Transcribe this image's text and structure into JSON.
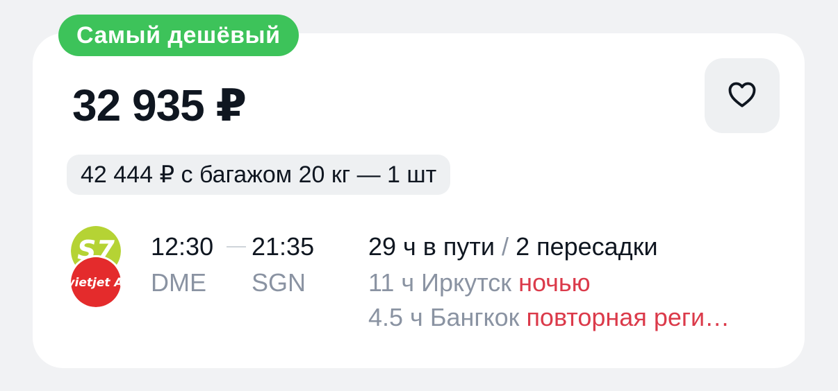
{
  "badge": {
    "label": "Самый дешёвый"
  },
  "price": {
    "value": "32 935 ₽"
  },
  "favorite": {
    "icon": "heart-icon"
  },
  "baggage": {
    "label": "42 444 ₽ с багажом 20 кг — 1 шт"
  },
  "airlines": [
    {
      "name": "S7",
      "logo_text": "S7",
      "color": "#b5d334"
    },
    {
      "name": "VietJet Air",
      "logo_text": "vietjet A",
      "color": "#e42b2c"
    }
  ],
  "flight": {
    "departure_time": "12:30",
    "arrival_time": "21:35",
    "departure_airport": "DME",
    "arrival_airport": "SGN",
    "duration": "29 ч в пути",
    "separator": "/",
    "stops": "2 пересадки",
    "layovers": [
      {
        "duration": "11 ч",
        "city": "Иркутск",
        "warning": "ночью"
      },
      {
        "duration": "4.5 ч",
        "city": "Бангкок",
        "warning": "повторная реги…"
      }
    ]
  },
  "colors": {
    "badge": "#3dc35a",
    "warning": "#db3a4a",
    "secondary_text": "#8a93a2",
    "primary_text": "#0f1620"
  }
}
